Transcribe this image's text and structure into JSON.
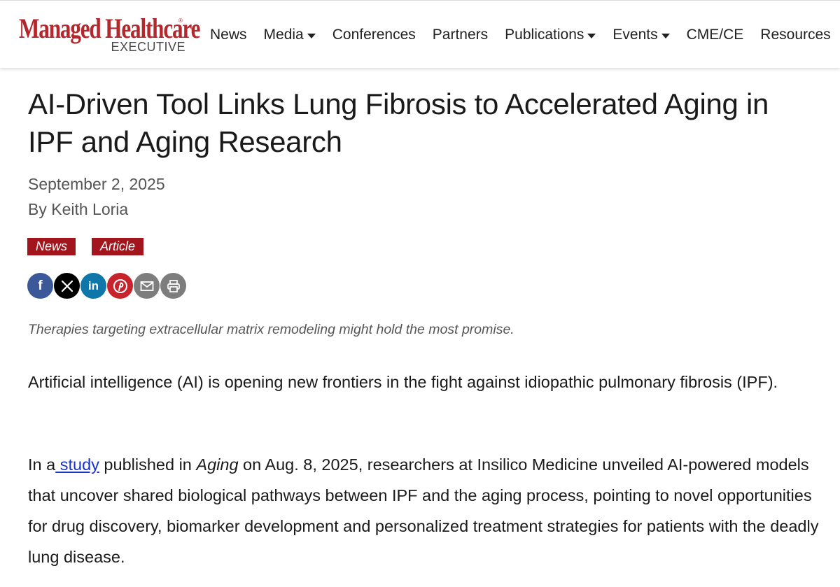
{
  "header": {
    "logo_main": "Managed Healthcare",
    "logo_reg": "®",
    "logo_sub": "EXECUTIVE",
    "nav": [
      {
        "label": "News",
        "dropdown": false
      },
      {
        "label": "Media",
        "dropdown": true
      },
      {
        "label": "Conferences",
        "dropdown": false
      },
      {
        "label": "Partners",
        "dropdown": false
      },
      {
        "label": "Publications",
        "dropdown": true
      },
      {
        "label": "Events",
        "dropdown": true
      },
      {
        "label": "CME/CE",
        "dropdown": false
      },
      {
        "label": "Resources",
        "dropdown": false
      }
    ]
  },
  "article": {
    "title": "AI-Driven Tool Links Lung Fibrosis to Accelerated Aging in IPF and Aging Research",
    "date": "September 2, 2025",
    "byline": "By Keith Loria",
    "tags": [
      "News",
      "Article"
    ],
    "share": [
      {
        "icon": "facebook-icon",
        "glyph": "f",
        "color": "#3b5998"
      },
      {
        "icon": "x-icon",
        "glyph": "X",
        "color": "#000000"
      },
      {
        "icon": "linkedin-icon",
        "glyph": "in",
        "color": "#0e76a8"
      },
      {
        "icon": "pinterest-icon",
        "glyph": "P",
        "color": "#c8232c"
      },
      {
        "icon": "email-icon",
        "glyph": "",
        "color": "#7d7d7d"
      },
      {
        "icon": "print-icon",
        "glyph": "",
        "color": "#7d7d7d"
      }
    ],
    "caption": "Therapies targeting extracellular matrix remodeling might hold the most promise.",
    "p1": "Artificial intelligence (AI) is opening new frontiers in the fight against idiopathic pulmonary fibrosis (IPF).",
    "p2_before": "In a",
    "p2_link": " study",
    "p2_mid": " published in ",
    "p2_italic": "Aging",
    "p2_after": " on Aug. 8, 2025, researchers at Insilico Medicine unveiled AI-powered models that uncover shared biological pathways between IPF and the aging process, pointing to novel opportunities for drug discovery, biomarker development and personalized treatment strategies for patients with the deadly lung disease."
  }
}
